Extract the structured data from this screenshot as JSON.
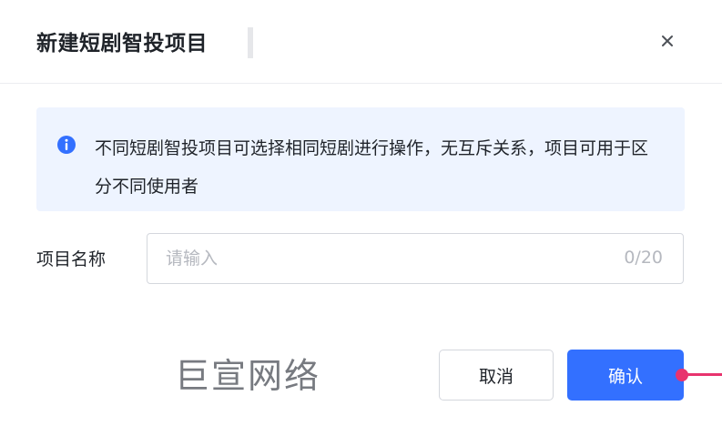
{
  "dialog": {
    "title": "新建短剧智投项目",
    "close_icon": "close-icon"
  },
  "notice": {
    "icon": "info-icon",
    "text": "不同短剧智投项目可选择相同短剧进行操作，无互斥关系，项目可用于区分不同使用者"
  },
  "form": {
    "name_label": "项目名称",
    "name_value": "",
    "name_placeholder": "请输入",
    "name_count": "0/20"
  },
  "watermark": "巨宣网络",
  "buttons": {
    "cancel_label": "取消",
    "confirm_label": "确认"
  },
  "colors": {
    "primary": "#3370ff",
    "notice_bg": "#eef4ff",
    "pointer": "#e8336e"
  }
}
